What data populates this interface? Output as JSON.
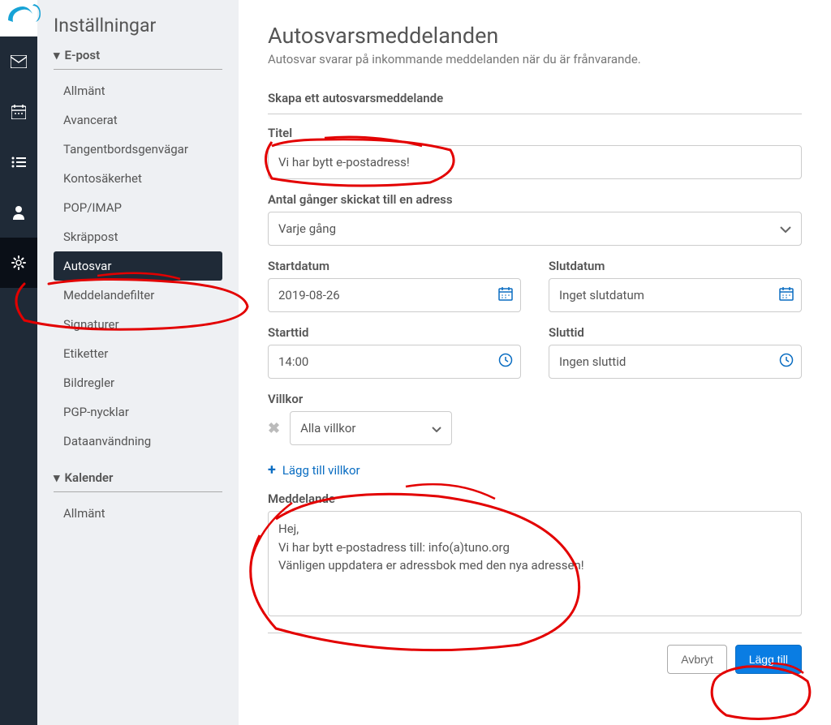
{
  "icon_sidebar": {
    "items": [
      {
        "name": "mail-icon"
      },
      {
        "name": "calendar-icon"
      },
      {
        "name": "list-icon"
      },
      {
        "name": "user-icon"
      },
      {
        "name": "gear-icon"
      }
    ],
    "active_index": 4
  },
  "settings_sidebar": {
    "title": "Inställningar",
    "categories": [
      {
        "label": "E-post",
        "items": [
          "Allmänt",
          "Avancerat",
          "Tangentbordsgenvägar",
          "Kontosäkerhet",
          "POP/IMAP",
          "Skräppost",
          "Autosvar",
          "Meddelandefilter",
          "Signaturer",
          "Etiketter",
          "Bildregler",
          "PGP-nycklar",
          "Dataanvändning"
        ],
        "active_index": 6
      },
      {
        "label": "Kalender",
        "items": [
          "Allmänt"
        ]
      }
    ]
  },
  "main": {
    "title": "Autosvarsmeddelanden",
    "subtitle": "Autosvar svarar på inkommande meddelanden när du är frånvarande.",
    "section_heading": "Skapa ett autosvarsmeddelande",
    "fields": {
      "title_label": "Titel",
      "title_value": "Vi har bytt e-postadress!",
      "send_count_label": "Antal gånger skickat till en adress",
      "send_count_value": "Varje gång",
      "start_date_label": "Startdatum",
      "start_date_value": "2019-08-26",
      "end_date_label": "Slutdatum",
      "end_date_value": "Inget slutdatum",
      "start_time_label": "Starttid",
      "start_time_value": "14:00",
      "end_time_label": "Sluttid",
      "end_time_value": "Ingen sluttid",
      "conditions_label": "Villkor",
      "conditions_value": "Alla villkor",
      "add_condition": "Lägg till villkor",
      "message_label": "Meddelande",
      "message_value": "Hej,\nVi har bytt e-postadress till: info(a)tuno.org\nVänligen uppdatera er adressbok med den nya adressen!"
    },
    "buttons": {
      "cancel": "Avbryt",
      "submit": "Lägg till"
    }
  },
  "colors": {
    "accent": "#0a7de3",
    "annotation": "#e30000"
  }
}
